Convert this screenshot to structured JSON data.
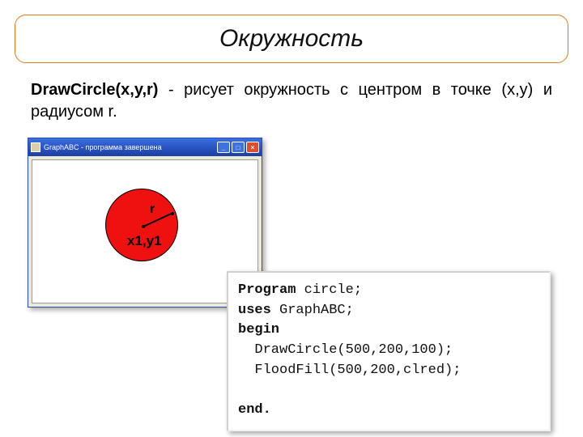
{
  "title": "Окружность",
  "description": {
    "bold": "DrawCircle(x,y,r)",
    "rest": " - рисует окружность с центром в точке (x,y) и радиусом r."
  },
  "window": {
    "title": "GraphABC - программа завершена",
    "btn_min": "_",
    "btn_max": "□",
    "btn_close": "×",
    "label_r": "r",
    "label_xy": "x1,y1"
  },
  "code": {
    "l1a": "Program",
    "l1b": " circle;",
    "l2a": "uses",
    "l2b": " GraphABC;",
    "l3": "begin",
    "l4": "  DrawCircle(500,200,100);",
    "l5": "  FloodFill(500,200,clred);",
    "blank": "",
    "l6": "end."
  }
}
